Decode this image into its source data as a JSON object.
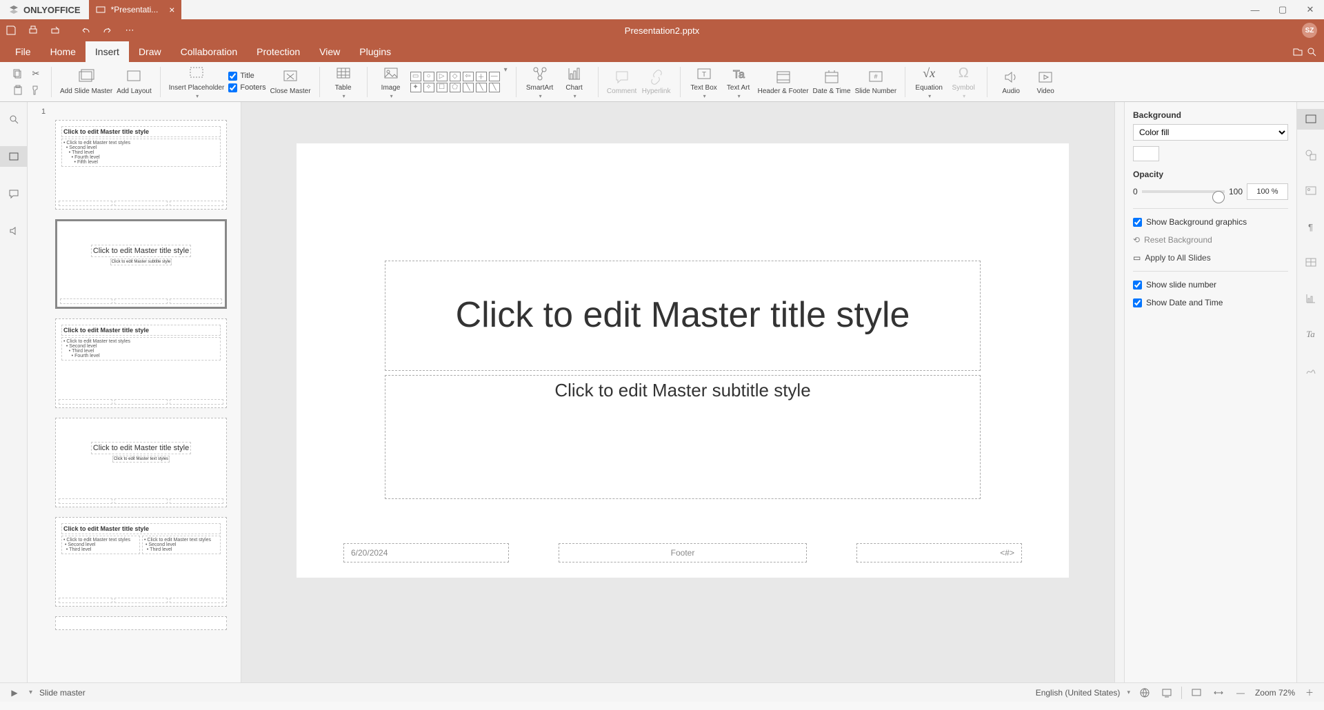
{
  "app": {
    "name": "ONLYOFFICE"
  },
  "tab": {
    "title": "*Presentati..."
  },
  "docTitle": "Presentation2.pptx",
  "avatar": "SZ",
  "menus": [
    "File",
    "Home",
    "Insert",
    "Draw",
    "Collaboration",
    "Protection",
    "View",
    "Plugins"
  ],
  "activeMenu": 2,
  "ribbon": {
    "addSlideMaster": "Add Slide Master",
    "addLayout": "Add Layout",
    "insertPlaceholder": "Insert Placeholder",
    "titleChk": "Title",
    "footersChk": "Footers",
    "closeMaster": "Close Master",
    "table": "Table",
    "image": "Image",
    "smartart": "SmartArt",
    "chart": "Chart",
    "comment": "Comment",
    "hyperlink": "Hyperlink",
    "textBox": "Text Box",
    "textArt": "Text Art",
    "headerFooter": "Header & Footer",
    "dateTime": "Date & Time",
    "slideNumber": "Slide Number",
    "equation": "Equation",
    "symbol": "Symbol",
    "audio": "Audio",
    "video": "Video"
  },
  "thumbs": {
    "num": "1",
    "masterTitle": "Click to edit Master title style",
    "masterText": "Click to edit Master text styles",
    "l2": "Second level",
    "l3": "Third level",
    "l4": "Fourth level",
    "l5": "Fifth level",
    "layoutTitleCenter": "Click to edit Master title style",
    "layoutSubCenter": "Click to edit Master subtitle style"
  },
  "slide": {
    "title": "Click to edit Master title style",
    "subtitle": "Click to edit Master subtitle style",
    "date": "6/20/2024",
    "footer": "Footer",
    "num": "<#>"
  },
  "panel": {
    "background": "Background",
    "fillType": "Color fill",
    "opacity": "Opacity",
    "opMin": "0",
    "opMax": "100",
    "opVal": "100 %",
    "showBg": "Show Background graphics",
    "reset": "Reset Background",
    "applyAll": "Apply to All Slides",
    "showNum": "Show slide number",
    "showDate": "Show Date and Time"
  },
  "status": {
    "mode": "Slide master",
    "lang": "English (United States)",
    "zoom": "Zoom 72%"
  }
}
